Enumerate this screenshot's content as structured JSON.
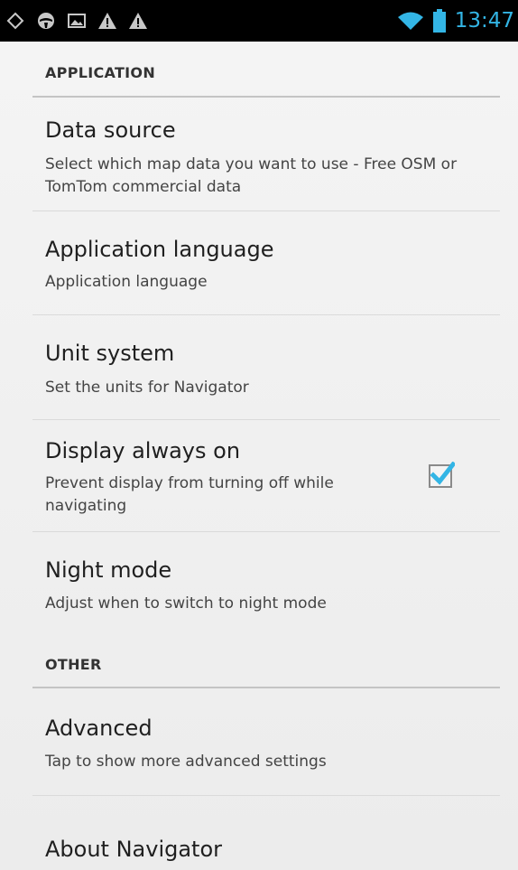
{
  "status_bar": {
    "time": "13:47",
    "left_icons": [
      "gps-icon",
      "app-notification-icon",
      "image-icon",
      "warning-icon",
      "warning-icon"
    ],
    "right_icons": [
      "wifi-icon",
      "battery-icon"
    ],
    "accent_color": "#33b5e5"
  },
  "sections": [
    {
      "label": "APPLICATION",
      "items": [
        {
          "title": "Data source",
          "summary": "Select which map data you want to use - Free OSM or TomTom commercial data"
        },
        {
          "title": "Application language",
          "summary": "Application language"
        },
        {
          "title": "Unit system",
          "summary": "Set the units for Navigator"
        },
        {
          "title": "Display always on",
          "summary": "Prevent display from turning off while navigating",
          "checked": true
        },
        {
          "title": "Night mode",
          "summary": "Adjust when to switch to night mode"
        }
      ]
    },
    {
      "label": "OTHER",
      "items": [
        {
          "title": "Advanced",
          "summary": "Tap to show more advanced settings"
        },
        {
          "title": "About Navigator"
        }
      ]
    }
  ]
}
